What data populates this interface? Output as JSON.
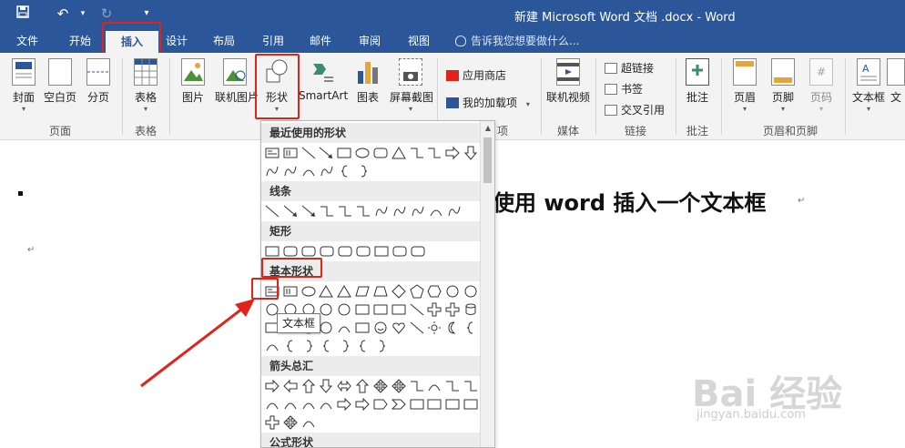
{
  "titlebar": {
    "doc_title": "新建 Microsoft Word 文档 .docx - Word",
    "save_icon": "save-icon",
    "undo_icon": "undo-icon",
    "redo_icon": "redo-icon",
    "customize_icon": "customize-quick-access-icon"
  },
  "tabs": [
    "文件",
    "开始",
    "插入",
    "设计",
    "布局",
    "引用",
    "邮件",
    "审阅",
    "视图"
  ],
  "active_tab": "插入",
  "tell_me": "告诉我您想要做什么...",
  "ribbon": {
    "pages": {
      "cover": "封面",
      "blank": "空白页",
      "break": "分页",
      "label": "页面"
    },
    "tables": {
      "table": "表格",
      "label": "表格"
    },
    "illustrations": {
      "picture": "图片",
      "online_picture": "联机图片",
      "shapes": "形状",
      "smartart": "SmartArt",
      "chart": "图表",
      "screenshot": "屏幕截图"
    },
    "addins": {
      "store": "应用商店",
      "my_addins": "我的加载项",
      "label": "项"
    },
    "media": {
      "online_video": "联机视频",
      "label": "媒体"
    },
    "links": {
      "hyperlink": "超链接",
      "bookmark": "书签",
      "cross_ref": "交叉引用",
      "label": "链接"
    },
    "comments": {
      "comment": "批注",
      "label": "批注"
    },
    "header_footer": {
      "header": "页眉",
      "footer": "页脚",
      "page_number": "页码",
      "label": "页眉和页脚"
    },
    "text": {
      "textbox": "文本框",
      "more": "文"
    }
  },
  "gallery": {
    "categories": [
      "最近使用的形状",
      "线条",
      "矩形",
      "基本形状",
      "箭头总汇",
      "公式形状"
    ],
    "tooltip": "文本框"
  },
  "document": {
    "heading": "使用 word 插入一个文本框",
    "para_mark": "↵"
  },
  "watermark": {
    "brand": "Bai 经验",
    "url": "jingyan.baidu.com"
  },
  "colors": {
    "accent": "#2b579a",
    "highlight": "#e2231a",
    "ribbon_bg": "#f3f3f3"
  }
}
